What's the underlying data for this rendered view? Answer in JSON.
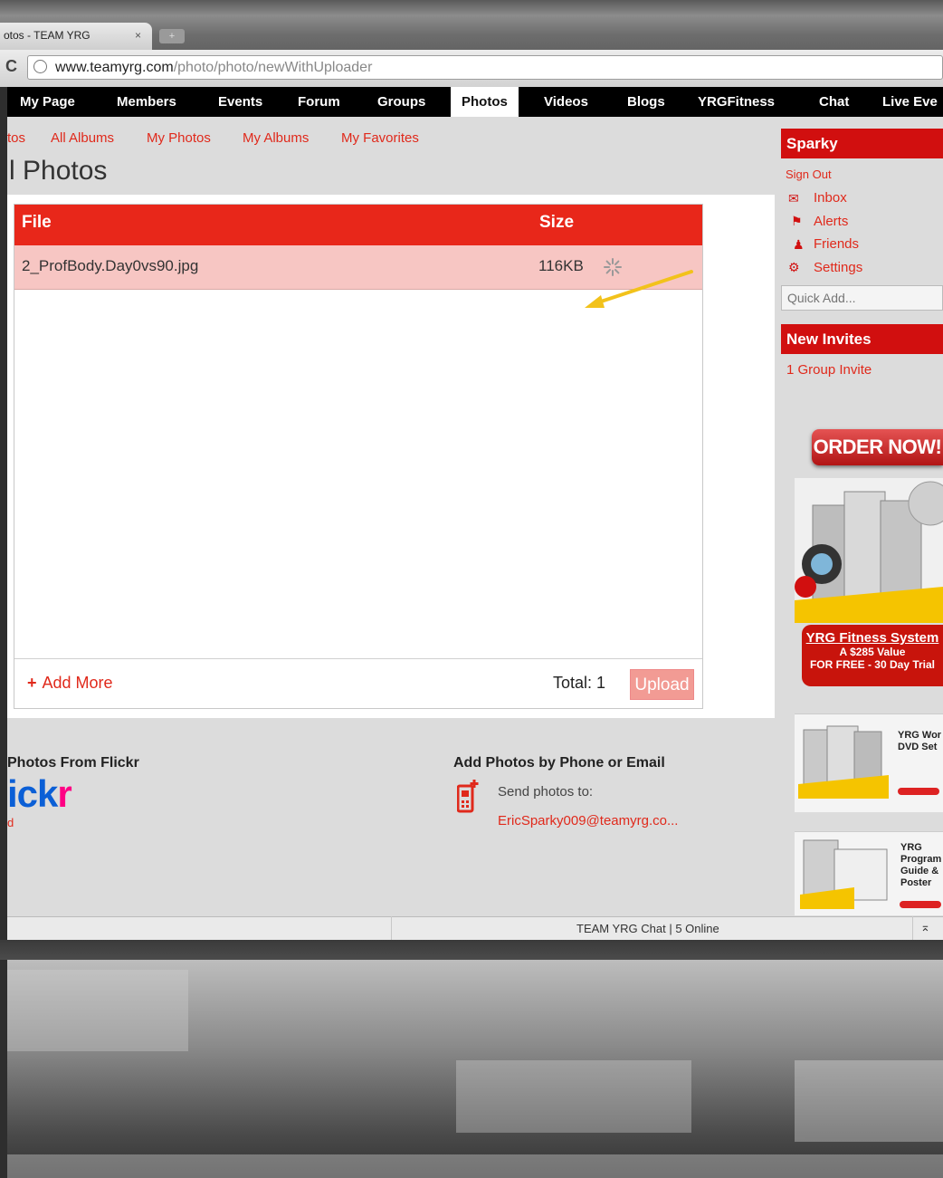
{
  "browser": {
    "tab_title": "otos - TEAM YRG",
    "tab_close": "×",
    "new_tab": "+",
    "url_host": "www.teamyrg.com",
    "url_path": "/photo/photo/newWithUploader"
  },
  "nav": {
    "items": [
      "My Page",
      "Members",
      "Events",
      "Forum",
      "Groups",
      "Photos",
      "Videos",
      "Blogs",
      "YRGFitness",
      "Chat",
      "Live Eve"
    ],
    "active": "Photos"
  },
  "subnav": {
    "items": [
      "tos",
      "All Albums",
      "My Photos",
      "My Albums",
      "My Favorites"
    ]
  },
  "page_title": "l Photos",
  "uploader": {
    "col_file": "File",
    "col_size": "Size",
    "file_name": "2_ProfBody.Day0vs90.jpg",
    "file_size": "116KB",
    "add_more": "Add More",
    "add_more_plus": "+",
    "total": "Total: 1",
    "upload_button": "Upload"
  },
  "flickr": {
    "heading": "Photos From Flickr",
    "logo_blue": "ick",
    "logo_pink": "r",
    "link": "d"
  },
  "phone": {
    "heading": "Add Photos by Phone or Email",
    "send_label": "Send photos to:",
    "email": "EricSparky009@teamyrg.co..."
  },
  "sidebar": {
    "user_name": "Sparky",
    "sign_out": "Sign Out",
    "links": [
      "Inbox",
      "Alerts",
      "Friends",
      "Settings"
    ],
    "quick_add_placeholder": "Quick Add...",
    "new_invites_heading": "New Invites",
    "invite_link": "1 Group Invite",
    "order_now": "ORDER NOW!",
    "promo_title": "YRG Fitness System",
    "promo_line2": "A $285 Value",
    "promo_line3": "FOR FREE - 30 Day Trial",
    "ad1_text": "YRG Wor DVD Set",
    "ad2_text": "YRG Program Guide & Poster"
  },
  "chat_bar": {
    "text": "TEAM YRG Chat | 5 Online",
    "toggle": "⌅"
  },
  "colors": {
    "brand_red": "#e8271a",
    "row_highlight": "#f7c6c3",
    "nav_bg": "#000000",
    "arrow": "#f2c21b"
  },
  "icons": [
    "reload-icon",
    "globe-icon",
    "spinner-icon",
    "arrow-annotation",
    "phone-icon",
    "inbox-icon",
    "alerts-icon",
    "friends-icon",
    "settings-icon"
  ]
}
